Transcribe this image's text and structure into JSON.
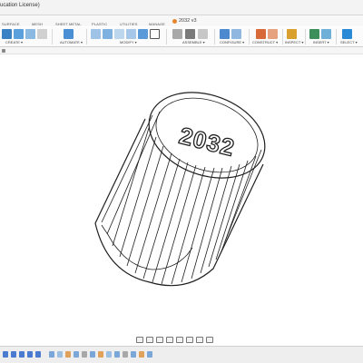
{
  "window": {
    "title": "ucation License)"
  },
  "document_tab": {
    "title": "2032 v3",
    "icon": "fusion-doc-icon",
    "icon_color": "#e8862f"
  },
  "workspace_tabs": [
    "SURFACE",
    "MESH",
    "SHEET METAL",
    "PLASTIC",
    "UTILITIES",
    "MANAGE"
  ],
  "ribbon": {
    "groups": [
      {
        "label": "CREATE ▾",
        "icon_color": "#3b82c4"
      },
      {
        "label": "AUTOMATE ▾",
        "icon_color": "#4a8fd4"
      },
      {
        "label": "MODIFY ▾",
        "icon_color": "#5a9ad8"
      },
      {
        "label": "ASSEMBLE ▾",
        "icon_color": "#7a7a7a"
      },
      {
        "label": "CONFIGURE ▾",
        "icon_color": "#4d89cf"
      },
      {
        "label": "CONSTRUCT ▾",
        "icon_color": "#d86a3a"
      },
      {
        "label": "INSPECT ▾",
        "icon_color": "#d9a02e"
      },
      {
        "label": "INSERT ▾",
        "icon_color": "#3c8f5a"
      },
      {
        "label": "SELECT ▾",
        "icon_color": "#2b8ad6"
      }
    ]
  },
  "model": {
    "emboss_text": "2032",
    "description_icon": "fluted-cylinder-model"
  },
  "navbar": {
    "icons": [
      "orbit-icon",
      "pan-icon",
      "hand-icon",
      "zoom-icon",
      "zoom-window-icon",
      "display-mode-icon",
      "grid-icon",
      "viewports-icon"
    ]
  },
  "timeline": {
    "controls": [
      "go-to-start-icon",
      "previous-step-icon",
      "play-icon",
      "next-step-icon",
      "go-to-end-icon"
    ]
  },
  "colors": {
    "accent": "#2b8ad6",
    "outline": "#1f1f1f"
  }
}
